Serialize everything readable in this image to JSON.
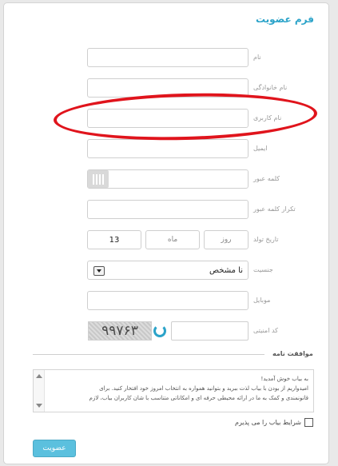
{
  "form": {
    "title": "فرم عضویت",
    "fields": {
      "first_name": "نام",
      "last_name": "نام خانوادگی",
      "username": "نام کاربری",
      "email": "ایمیل",
      "password": "کلمه عبور",
      "password_repeat": "تکرار کلمه عبور",
      "birth_date": "تاریخ تولد",
      "gender": "جنسیت",
      "mobile": "موبایل",
      "captcha": "کد امنیتی"
    },
    "birth_date_parts": {
      "day": "روز",
      "month": "ماه",
      "year": "13"
    },
    "gender_selected": "نا مشخص",
    "captcha_image_text": "۹۹۷۶۳",
    "agreement": {
      "heading": "موافقت نامه",
      "lines": [
        "به بیاب خوش آمدید!",
        "امیدواریم از بودن با بیاب لذت ببرید و بتوانید همواره به انتخاب امروز خود افتخار کنید. برای",
        "قانونمندی و کمک به ما در ارائه محیطی حرفه ای و امکاناتی متناسب با شان کاربران بیاب، لازم"
      ]
    },
    "accept_terms": "شرایط بیاب را می پذیرم",
    "submit": "عضویت"
  },
  "colors": {
    "accent": "#2ba3c9",
    "button": "#5bc0de",
    "annotation": "#e0141c"
  }
}
